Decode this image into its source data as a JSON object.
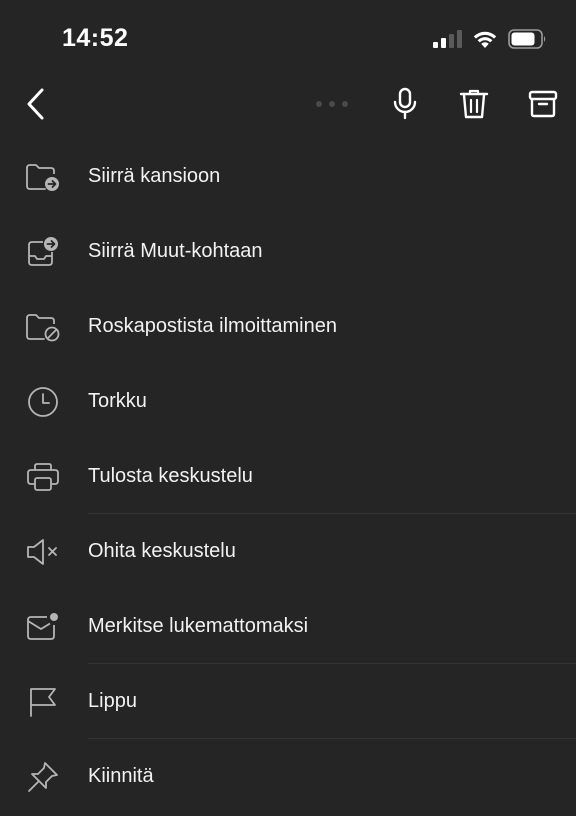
{
  "status_bar": {
    "time": "14:52",
    "signal_icon": "cellular-signal-icon",
    "wifi_icon": "wifi-icon",
    "battery_icon": "battery-icon"
  },
  "nav_bar": {
    "back_icon": "chevron-left-icon",
    "more_icon": "more-dots-icon",
    "mic_icon": "microphone-icon",
    "trash_icon": "trash-icon",
    "archive_icon": "archive-icon"
  },
  "menu": {
    "items": [
      {
        "label": "Siirrä kansioon",
        "icon": "folder-move-icon"
      },
      {
        "label": "Siirrä Muut-kohtaan",
        "icon": "inbox-move-icon"
      },
      {
        "label": "Roskapostista ilmoittaminen",
        "icon": "folder-block-icon"
      },
      {
        "label": "Torkku",
        "icon": "clock-icon"
      },
      {
        "label": "Tulosta keskustelu",
        "icon": "printer-icon"
      },
      {
        "label": "Ohita keskustelu",
        "icon": "speaker-mute-icon"
      },
      {
        "label": "Merkitse lukemattomaksi",
        "icon": "mail-unread-icon"
      },
      {
        "label": "Lippu",
        "icon": "flag-icon"
      },
      {
        "label": "Kiinnitä",
        "icon": "pin-icon"
      }
    ]
  },
  "colors": {
    "background": "#252525",
    "text": "#f2f2f2",
    "icon": "#b5b5b5",
    "divider": "#353535"
  }
}
